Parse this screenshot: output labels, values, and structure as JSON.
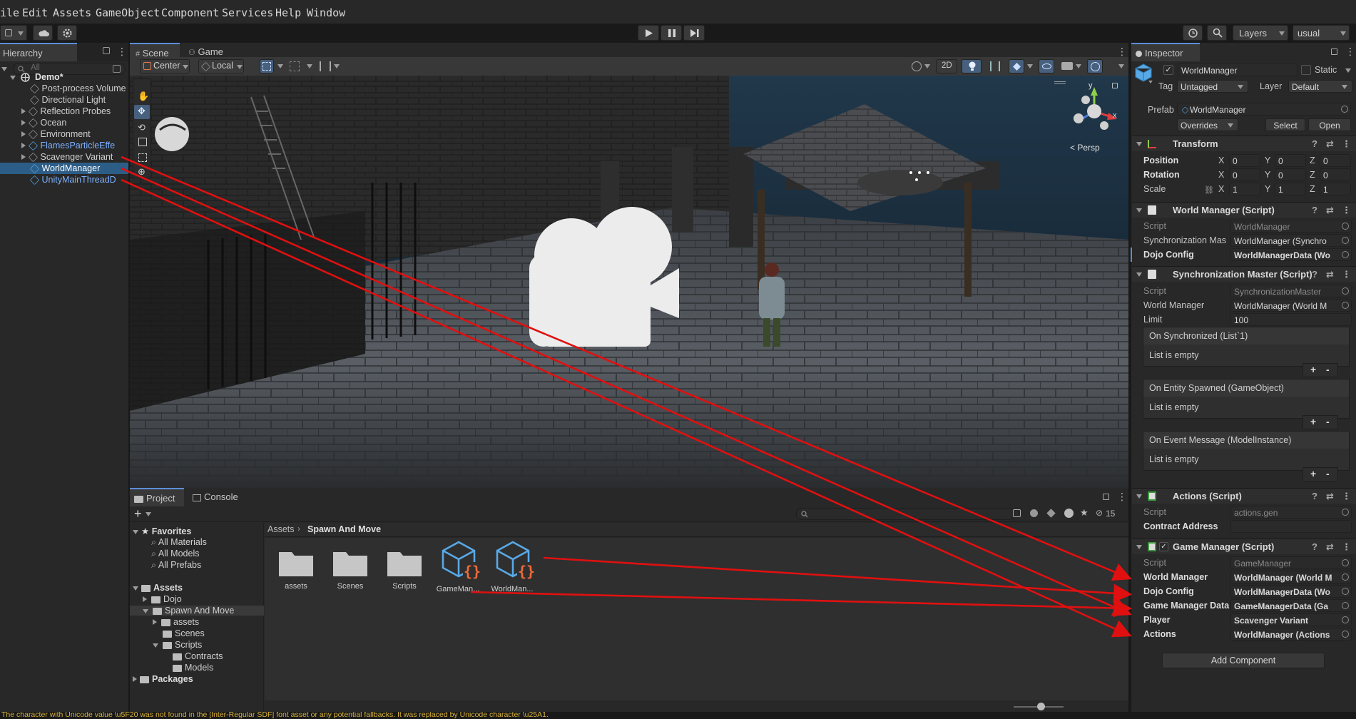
{
  "menubar": {
    "items": [
      "ile",
      "Edit",
      "Assets",
      "GameObject",
      "Component",
      "Services",
      "Help",
      "Window"
    ]
  },
  "toolbar": {
    "layers_label": "Layers",
    "layout_label": "usual"
  },
  "hierarchy": {
    "tab_label": "Hierarchy",
    "search_placeholder": "All",
    "scene_name": "Demo*",
    "items": [
      {
        "label": "Post-process Volume",
        "prefab": false
      },
      {
        "label": "Directional Light",
        "prefab": false
      },
      {
        "label": "Reflection Probes",
        "prefab": false
      },
      {
        "label": "Ocean",
        "prefab": false
      },
      {
        "label": "Environment",
        "prefab": false
      },
      {
        "label": "FlamesParticleEffe",
        "prefab": true
      },
      {
        "label": "Scavenger Variant",
        "prefab": false
      },
      {
        "label": "WorldManager",
        "prefab": true,
        "selected": true
      },
      {
        "label": "UnityMainThreadD",
        "prefab": true
      }
    ]
  },
  "scene_view": {
    "tabs": [
      "Scene",
      "Game"
    ],
    "pivot_label": "Center",
    "space_label": "Local",
    "mode_2d_label": "2D",
    "gizmo_y": "y",
    "gizmo_x": "x",
    "persp_label": "< Persp"
  },
  "project": {
    "tabs": [
      "Project",
      "Console"
    ],
    "hidden_count": "15",
    "favorites_label": "Favorites",
    "favorites": [
      "All Materials",
      "All Models",
      "All Prefabs"
    ],
    "assets_label": "Assets",
    "tree": [
      "Dojo",
      "Spawn And Move",
      "assets",
      "Scenes",
      "Scripts",
      "Contracts",
      "Models"
    ],
    "packages_label": "Packages",
    "breadcrumb": [
      "Assets",
      "Spawn And Move"
    ],
    "files": [
      {
        "name": "assets",
        "kind": "folder"
      },
      {
        "name": "Scenes",
        "kind": "folder"
      },
      {
        "name": "Scripts",
        "kind": "folder"
      },
      {
        "name": "GameMan...",
        "kind": "prefab"
      },
      {
        "name": "WorldMan...",
        "kind": "prefab"
      }
    ]
  },
  "inspector": {
    "tab_label": "Inspector",
    "object_name": "WorldManager",
    "static_label": "Static",
    "tag_label": "Tag",
    "tag_value": "Untagged",
    "layer_label": "Layer",
    "layer_value": "Default",
    "prefab_label": "Prefab",
    "prefab_value": "WorldManager",
    "overrides_label": "Overrides",
    "select_label": "Select",
    "open_label": "Open",
    "transform": {
      "title": "Transform",
      "position_label": "Position",
      "rotation_label": "Rotation",
      "scale_label": "Scale",
      "position": [
        "0",
        "0",
        "0"
      ],
      "rotation": [
        "0",
        "0",
        "0"
      ],
      "scale": [
        "1",
        "1",
        "1"
      ],
      "axes": [
        "X",
        "Y",
        "Z"
      ]
    },
    "world_manager": {
      "title": "World Manager (Script)",
      "script_label": "Script",
      "script_value": "WorldManager",
      "sync_label": "Synchronization Mas",
      "sync_value": "WorldManager (Synchro",
      "dojo_label": "Dojo Config",
      "dojo_value": "WorldManagerData (Wo"
    },
    "sync_master": {
      "title": "Synchronization Master (Script)",
      "script_label": "Script",
      "script_value": "SynchronizationMaster",
      "wm_label": "World Manager",
      "wm_value": "WorldManager (World M",
      "limit_label": "Limit",
      "limit_value": "100",
      "events": [
        {
          "title": "On Synchronized (List`1)",
          "body": "List is empty"
        },
        {
          "title": "On Entity Spawned (GameObject)",
          "body": "List is empty"
        },
        {
          "title": "On Event Message (ModelInstance)",
          "body": "List is empty"
        }
      ],
      "plus": "+",
      "minus": "-"
    },
    "actions": {
      "title": "Actions (Script)",
      "script_label": "Script",
      "script_value": "actions.gen",
      "contract_label": "Contract Address",
      "contract_value": ""
    },
    "game_manager": {
      "title": "Game Manager (Script)",
      "script_label": "Script",
      "script_value": "GameManager",
      "rows": [
        {
          "label": "World Manager",
          "value": "WorldManager (World M"
        },
        {
          "label": "Dojo Config",
          "value": "WorldManagerData (Wo"
        },
        {
          "label": "Game Manager Data",
          "value": "GameManagerData (Ga"
        },
        {
          "label": "Player",
          "value": "Scavenger Variant"
        },
        {
          "label": "Actions",
          "value": "WorldManager (Actions"
        }
      ]
    },
    "add_component_label": "Add Component"
  },
  "status_bar": {
    "message": "The character with Unicode value \\u5F20 was not found in the [Inter-Regular SDF] font asset or any potential fallbacks. It was replaced by Unicode character \\u25A1."
  },
  "colors": {
    "accent": "#5b8fd6",
    "selection": "#2c5d87",
    "prefab_text": "#7cb1ff",
    "annotation_arrow": "#e01010",
    "warning_text": "#d9b23a"
  }
}
